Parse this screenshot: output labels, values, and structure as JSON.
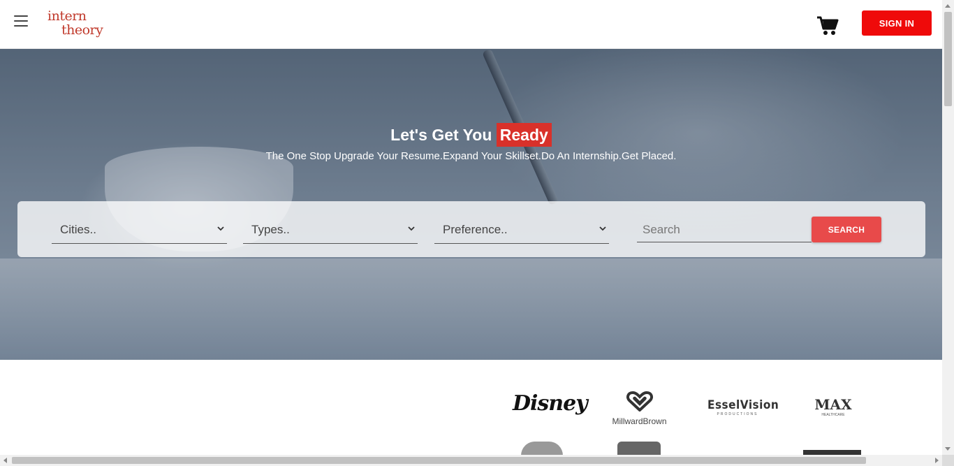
{
  "header": {
    "menu_icon": "hamburger-menu-icon",
    "logo": {
      "line1": "intern",
      "line2": "theory"
    },
    "cart_icon": "shopping-cart-icon",
    "signin_label": "SIGN IN",
    "accent": "#ef0a0a"
  },
  "hero": {
    "title_main": "Let's Get You",
    "title_highlight": "Ready",
    "subtitle": "The One Stop Upgrade Your Resume.Expand Your Skillset.Do An Internship.Get Placed."
  },
  "search_panel": {
    "cities": "Cities..",
    "types": "Types..",
    "preference": "Preference..",
    "search_placeholder": "Search",
    "search_button": "SEARCH",
    "button_color": "#e84a4a"
  },
  "brands": {
    "disney": "Disney",
    "millward": "MillwardBrown",
    "essel": "EsselVision",
    "essel_sub": "PRODUCTIONS",
    "max": "MAX",
    "max_sub": "HEALTHCARE"
  }
}
